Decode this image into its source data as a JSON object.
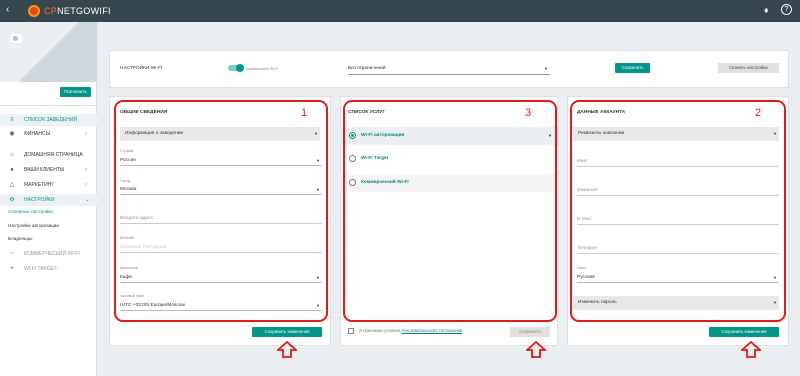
{
  "app": {
    "brand_prefix": "CP",
    "brand_suffix": "NETGOWIFI"
  },
  "topbar": {
    "back_icon": "arrow-left-icon",
    "bell_icon": "bell-icon",
    "help_label": "?"
  },
  "sidebar": {
    "replenish_label": "Пополнить",
    "items": [
      {
        "label": "СПИСОК ЗАВЕДЕНИЙ",
        "icon": "list-icon",
        "active": true
      },
      {
        "label": "ФИНАНСЫ",
        "icon": "wallet-icon"
      },
      {
        "label": "ДОМАШНЯЯ СТРАНИЦА",
        "icon": "home-icon"
      },
      {
        "label": "ВАШИ КЛИЕНТЫ",
        "icon": "people-icon"
      },
      {
        "label": "МАРКЕТИНГ",
        "icon": "network-icon"
      },
      {
        "label": "НАСТРОЙКИ",
        "icon": "gear-icon",
        "active": true
      },
      {
        "label": "КОММЕРЧЕСКИЙ WI-FI",
        "icon": "wifi-icon"
      },
      {
        "label": "WI-FI TARGET",
        "icon": "pin-icon"
      }
    ],
    "subitems": [
      "Основные настройки",
      "Настройка авторизации",
      "Владельцы"
    ]
  },
  "settings_bar": {
    "title": "НАСТРОЙКИ WI-FI",
    "toggle_label": "Активировать Wi-Fi",
    "limit_value": "Без ограничений",
    "save_label": "Сохранить",
    "download_label": "Скачать настройки"
  },
  "general": {
    "title": "ОБЩИЕ СВЕДЕНИЯ",
    "info_select": "Информация о заведении",
    "country_label": "Страна",
    "country_value": "Россия",
    "city_label": "Город",
    "city_value": "Москва",
    "address_placeholder": "Введите адрес",
    "website_label": "Вебсайт",
    "website_placeholder": "Название Ресторана",
    "category_label": "Категория",
    "category_value": "Кафе",
    "timezone_label": "Часовой пояс",
    "timezone_value": "(UTC +03:00) Europe/Moscow",
    "save_label": "Сохранить изменения",
    "marker": "1"
  },
  "services": {
    "title": "СПИСОК УСЛУГ",
    "items": [
      "Wi-Fi авторизация",
      "Wi-Fi Target",
      "Коммерческий Wi-Fi"
    ],
    "terms_prefix": "Я принимаю условия",
    "terms_link": "пользовательского соглашения",
    "save_label": "Сохранить",
    "marker": "3"
  },
  "account": {
    "title": "ДАННЫЕ АККАУНТА",
    "requisites_select": "Реквизиты компании",
    "name_placeholder": "Имя:",
    "surname_placeholder": "Фамилия:",
    "email_placeholder": "E-Mail:",
    "phone_placeholder": "Телефон",
    "language_label": "Язык",
    "language_value": "Русский",
    "password_select": "Изменить пароль",
    "save_label": "Сохранить изменения",
    "marker": "2"
  },
  "colors": {
    "accent": "#009688",
    "annotation": "#e01b1b",
    "topbar": "#37474f"
  }
}
